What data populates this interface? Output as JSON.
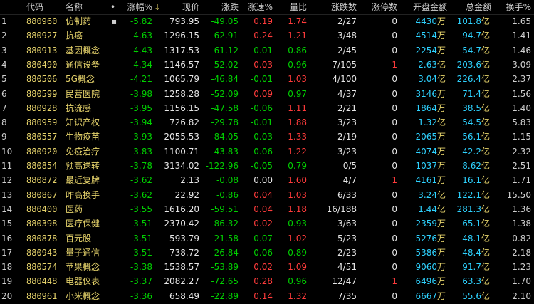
{
  "header": {
    "blank": "",
    "code": "代码",
    "name": "名称",
    "dot": "•",
    "chg_pct": "涨幅%",
    "sort_mark": "↓",
    "price": "现价",
    "change": "涨跌",
    "speed": "涨速%",
    "vol_ratio": "量比",
    "up_down_count": "涨跌数",
    "limit_up": "涨停数",
    "open_amt": "开盘金额",
    "total_amt": "总金额",
    "turnover": "换手%"
  },
  "rows": [
    {
      "i": "1",
      "code": "880960",
      "name": "仿制药",
      "mark": "▪",
      "chg": "-5.82",
      "price": "793.95",
      "change": "-49.05",
      "speed": "0.19",
      "vr": "1.74",
      "ud": "2/27",
      "lu": "0",
      "open": "4430",
      "open_unit": "万",
      "total": "101.8",
      "total_unit": "亿",
      "to": "1.65"
    },
    {
      "i": "2",
      "code": "880927",
      "name": "抗癌",
      "mark": "",
      "chg": "-4.63",
      "price": "1296.15",
      "change": "-62.91",
      "speed": "0.24",
      "vr": "1.21",
      "ud": "3/48",
      "lu": "0",
      "open": "4514",
      "open_unit": "万",
      "total": "94.7",
      "total_unit": "亿",
      "to": "1.41"
    },
    {
      "i": "3",
      "code": "880913",
      "name": "基因概念",
      "mark": "",
      "chg": "-4.43",
      "price": "1317.53",
      "change": "-61.12",
      "speed": "-0.01",
      "vr": "0.86",
      "ud": "2/45",
      "lu": "0",
      "open": "2254",
      "open_unit": "万",
      "total": "54.7",
      "total_unit": "亿",
      "to": "1.46"
    },
    {
      "i": "4",
      "code": "880490",
      "name": "通信设备",
      "mark": "",
      "chg": "-4.34",
      "price": "1146.57",
      "change": "-52.02",
      "speed": "0.03",
      "vr": "0.96",
      "ud": "7/105",
      "lu": "1",
      "open": "2.63",
      "open_unit": "亿",
      "total": "203.6",
      "total_unit": "亿",
      "to": "3.09"
    },
    {
      "i": "5",
      "code": "880506",
      "name": "5G概念",
      "mark": "",
      "chg": "-4.21",
      "price": "1065.79",
      "change": "-46.84",
      "speed": "-0.01",
      "vr": "1.03",
      "ud": "4/100",
      "lu": "0",
      "open": "3.04",
      "open_unit": "亿",
      "total": "226.4",
      "total_unit": "亿",
      "to": "2.37"
    },
    {
      "i": "6",
      "code": "880599",
      "name": "民营医院",
      "mark": "",
      "chg": "-3.98",
      "price": "1258.28",
      "change": "-52.09",
      "speed": "0.09",
      "vr": "0.97",
      "ud": "4/37",
      "lu": "0",
      "open": "3146",
      "open_unit": "万",
      "total": "71.4",
      "total_unit": "亿",
      "to": "1.56"
    },
    {
      "i": "7",
      "code": "880928",
      "name": "抗流感",
      "mark": "",
      "chg": "-3.95",
      "price": "1156.15",
      "change": "-47.58",
      "speed": "-0.06",
      "vr": "1.11",
      "ud": "2/21",
      "lu": "0",
      "open": "1864",
      "open_unit": "万",
      "total": "38.5",
      "total_unit": "亿",
      "to": "1.40"
    },
    {
      "i": "8",
      "code": "880959",
      "name": "知识产权",
      "mark": "",
      "chg": "-3.94",
      "price": "726.82",
      "change": "-29.78",
      "speed": "-0.01",
      "vr": "1.88",
      "ud": "3/23",
      "lu": "0",
      "open": "1.32",
      "open_unit": "亿",
      "total": "54.5",
      "total_unit": "亿",
      "to": "5.83"
    },
    {
      "i": "9",
      "code": "880557",
      "name": "生物疫苗",
      "mark": "",
      "chg": "-3.93",
      "price": "2055.53",
      "change": "-84.05",
      "speed": "-0.03",
      "vr": "1.33",
      "ud": "2/19",
      "lu": "0",
      "open": "2065",
      "open_unit": "万",
      "total": "56.1",
      "total_unit": "亿",
      "to": "1.15"
    },
    {
      "i": "10",
      "code": "880920",
      "name": "免疫治疗",
      "mark": "",
      "chg": "-3.83",
      "price": "1100.71",
      "change": "-43.83",
      "speed": "-0.06",
      "vr": "1.22",
      "ud": "3/23",
      "lu": "0",
      "open": "4074",
      "open_unit": "万",
      "total": "42.2",
      "total_unit": "亿",
      "to": "2.32"
    },
    {
      "i": "11",
      "code": "880854",
      "name": "预高送转",
      "mark": "",
      "chg": "-3.78",
      "price": "3134.02",
      "change": "-122.96",
      "speed": "-0.05",
      "vr": "0.79",
      "ud": "0/5",
      "lu": "0",
      "open": "1037",
      "open_unit": "万",
      "total": "8.62",
      "total_unit": "亿",
      "to": "2.51"
    },
    {
      "i": "12",
      "code": "880872",
      "name": "最近复牌",
      "mark": "",
      "chg": "-3.62",
      "price": "2.13",
      "change": "-0.08",
      "speed": "0.00",
      "vr": "1.60",
      "ud": "4/7",
      "lu": "1",
      "open": "4161",
      "open_unit": "万",
      "total": "16.1",
      "total_unit": "亿",
      "to": "1.71"
    },
    {
      "i": "13",
      "code": "880867",
      "name": "昨高换手",
      "mark": "",
      "chg": "-3.62",
      "price": "22.92",
      "change": "-0.86",
      "speed": "0.04",
      "vr": "1.03",
      "ud": "6/33",
      "lu": "0",
      "open": "3.24",
      "open_unit": "亿",
      "total": "122.1",
      "total_unit": "亿",
      "to": "15.50"
    },
    {
      "i": "14",
      "code": "880400",
      "name": "医药",
      "mark": "",
      "chg": "-3.55",
      "price": "1616.20",
      "change": "-59.51",
      "speed": "0.04",
      "vr": "1.18",
      "ud": "16/188",
      "lu": "0",
      "open": "1.44",
      "open_unit": "亿",
      "total": "281.3",
      "total_unit": "亿",
      "to": "1.36"
    },
    {
      "i": "15",
      "code": "880398",
      "name": "医疗保健",
      "mark": "",
      "chg": "-3.51",
      "price": "2370.42",
      "change": "-86.32",
      "speed": "0.02",
      "vr": "0.93",
      "ud": "3/63",
      "lu": "0",
      "open": "2359",
      "open_unit": "万",
      "total": "65.1",
      "total_unit": "亿",
      "to": "1.38"
    },
    {
      "i": "16",
      "code": "880878",
      "name": "百元股",
      "mark": "",
      "chg": "-3.51",
      "price": "593.79",
      "change": "-21.58",
      "speed": "-0.07",
      "vr": "1.02",
      "ud": "5/23",
      "lu": "0",
      "open": "5276",
      "open_unit": "万",
      "total": "48.1",
      "total_unit": "亿",
      "to": "0.82"
    },
    {
      "i": "17",
      "code": "880943",
      "name": "量子通信",
      "mark": "",
      "chg": "-3.51",
      "price": "738.72",
      "change": "-26.84",
      "speed": "-0.06",
      "vr": "0.89",
      "ud": "2/23",
      "lu": "0",
      "open": "5386",
      "open_unit": "万",
      "total": "48.4",
      "total_unit": "亿",
      "to": "2.18"
    },
    {
      "i": "18",
      "code": "880574",
      "name": "苹果概念",
      "mark": "",
      "chg": "-3.38",
      "price": "1538.57",
      "change": "-53.89",
      "speed": "0.02",
      "vr": "1.09",
      "ud": "4/51",
      "lu": "0",
      "open": "9060",
      "open_unit": "万",
      "total": "91.7",
      "total_unit": "亿",
      "to": "1.23"
    },
    {
      "i": "19",
      "code": "880448",
      "name": "电器仪表",
      "mark": "",
      "chg": "-3.37",
      "price": "2082.27",
      "change": "-72.65",
      "speed": "0.28",
      "vr": "0.96",
      "ud": "12/47",
      "lu": "1",
      "open": "6496",
      "open_unit": "万",
      "total": "63.3",
      "total_unit": "亿",
      "to": "1.70"
    },
    {
      "i": "20",
      "code": "880961",
      "name": "小米概念",
      "mark": "",
      "chg": "-3.36",
      "price": "658.49",
      "change": "-22.89",
      "speed": "0.14",
      "vr": "1.32",
      "ud": "7/35",
      "lu": "0",
      "open": "6667",
      "open_unit": "万",
      "total": "55.6",
      "total_unit": "亿",
      "to": "2.10"
    }
  ],
  "colors": {
    "down": "#00d000",
    "up": "#ff3b3b",
    "code": "#e6d36b",
    "amount": "#2ed2ff"
  }
}
